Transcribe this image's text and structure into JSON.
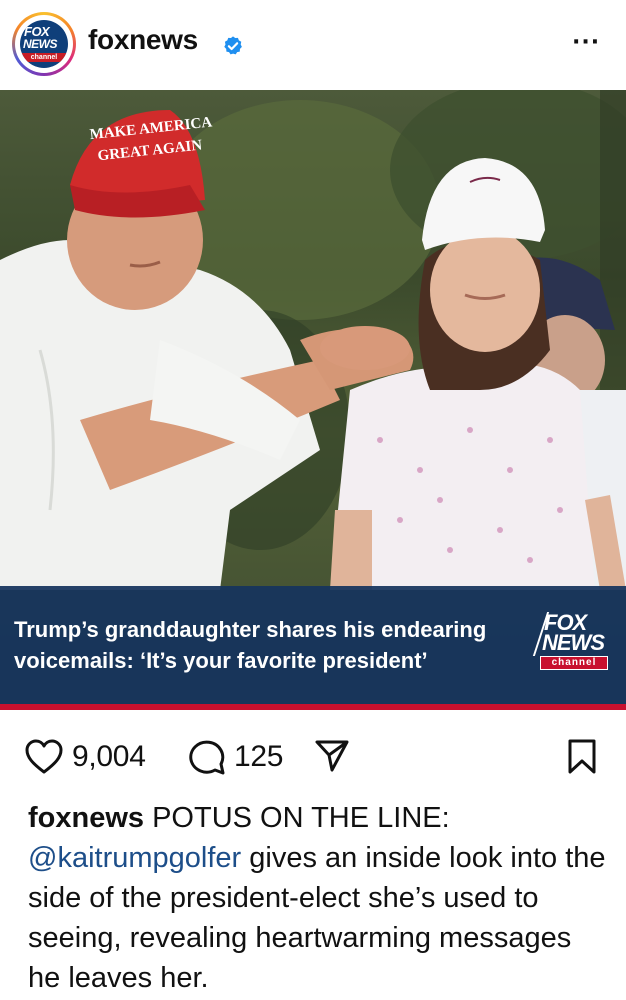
{
  "header": {
    "username": "foxnews",
    "avatar_text": {
      "fox": "FOX",
      "news": "NEWS",
      "channel": "channel"
    },
    "verified_icon": "verified-badge-icon",
    "more_icon": "more-options-icon",
    "more_label": "···"
  },
  "photo": {
    "cap_text_line1": "MAKE AMERICA",
    "cap_text_line2": "GREAT AGAIN",
    "headline": "Trump’s granddaughter shares his endearing voicemails: ‘It’s your favorite president’",
    "bug": {
      "fox": "FOX",
      "news": "NEWS",
      "channel": "channel"
    },
    "colors": {
      "banner": "#16345e",
      "stripe": "#c8102e"
    }
  },
  "actions": {
    "like_icon": "heart-icon",
    "like_count": "9,004",
    "comment_icon": "comment-bubble-icon",
    "comment_count": "125",
    "share_icon": "send-paper-plane-icon",
    "save_icon": "bookmark-icon"
  },
  "caption": {
    "username": "foxnews",
    "text_lead": " POTUS ON THE LINE: ",
    "mention": "@kaitrumpgolfer",
    "text_rest": " gives an inside look into the side of the president-elect she’s used to seeing, revealing heartwarming messages he leaves her."
  }
}
